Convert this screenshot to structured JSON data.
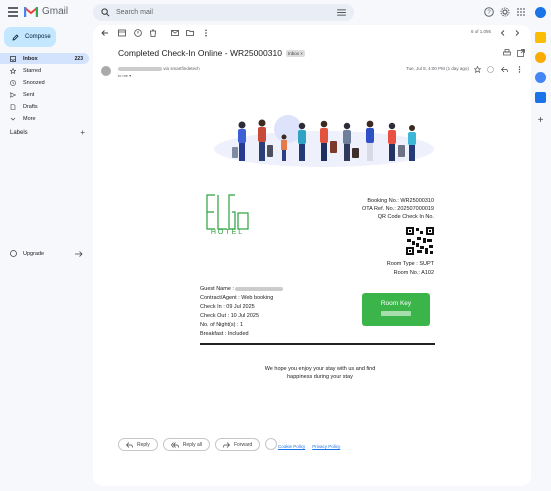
{
  "app": {
    "name": "Gmail"
  },
  "search": {
    "placeholder": "Search mail"
  },
  "sidebar": {
    "compose_label": "Compose",
    "items": [
      {
        "label": "Inbox",
        "count": "223"
      },
      {
        "label": "Starred"
      },
      {
        "label": "Snoozed"
      },
      {
        "label": "Sent"
      },
      {
        "label": "Drafts"
      },
      {
        "label": "More"
      }
    ],
    "labels_title": "Labels",
    "upgrade_label": "Upgrade"
  },
  "toolbar": {
    "pager": "6 of 1,095"
  },
  "email": {
    "subject": "Completed Check-In Online - WR25000310",
    "folder_badge": "Inbox ×",
    "sender_domain": "via smartfindetech",
    "to_label": "to me ▾",
    "date": "Tue, Jul 8, 4:00 PM (1 day ago)",
    "hotel_name": "HOTEL",
    "booking_no": "Booking No.:  WR25000310",
    "ota_ref": "OTA Ref. No.: 202507000019",
    "qr_title": "QR Code Check In No.",
    "room_type": "Room Type : SUPT",
    "room_no": "Room No.: A102",
    "guest_name": "Guest Name :",
    "contract": "Contract/Agent : Web booking",
    "check_in": "Check In : 09 Jul 2025",
    "check_out": "Check Out : 10 Jul 2025",
    "nights": "No. of Night(s) : 1",
    "breakfast": "Breakfast : Included",
    "room_key_label": "Room Key",
    "message_line1": "We hope you enjoy your stay with us and find",
    "message_line2": "happiness during your stay",
    "cookie_policy": "Cookie Policy",
    "privacy_policy": "Privacy Policy"
  },
  "actions": {
    "reply": "Reply",
    "reply_all": "Reply all",
    "forward": "Forward"
  },
  "colors": {
    "accent": "#c2e7ff",
    "active_nav": "#d3e3fd",
    "hotel_green": "#2aa23c",
    "room_key_bg": "#3bb54a"
  }
}
